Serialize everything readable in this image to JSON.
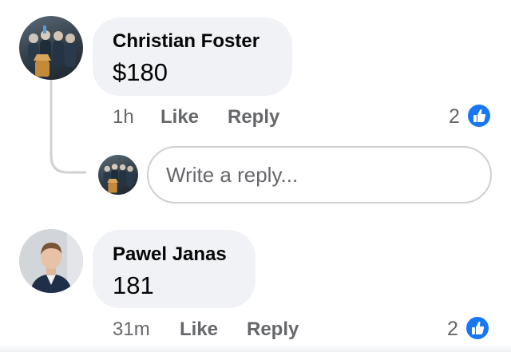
{
  "comments": [
    {
      "author": "Christian Foster",
      "text": "$180",
      "time": "1h",
      "like_label": "Like",
      "reply_label": "Reply",
      "reaction_count": "2",
      "reaction_icon": "thumbs-up-icon"
    },
    {
      "author": "Pawel Janas",
      "text": "181",
      "time": "31m",
      "like_label": "Like",
      "reply_label": "Reply",
      "reaction_count": "2",
      "reaction_icon": "thumbs-up-icon"
    }
  ],
  "reply_box": {
    "placeholder": "Write a reply..."
  },
  "colors": {
    "bubble": "#f0f2f5",
    "text_primary": "#050505",
    "text_secondary": "#65676b",
    "reaction_blue": "#1877f2",
    "thread_line": "#ced0d4"
  }
}
